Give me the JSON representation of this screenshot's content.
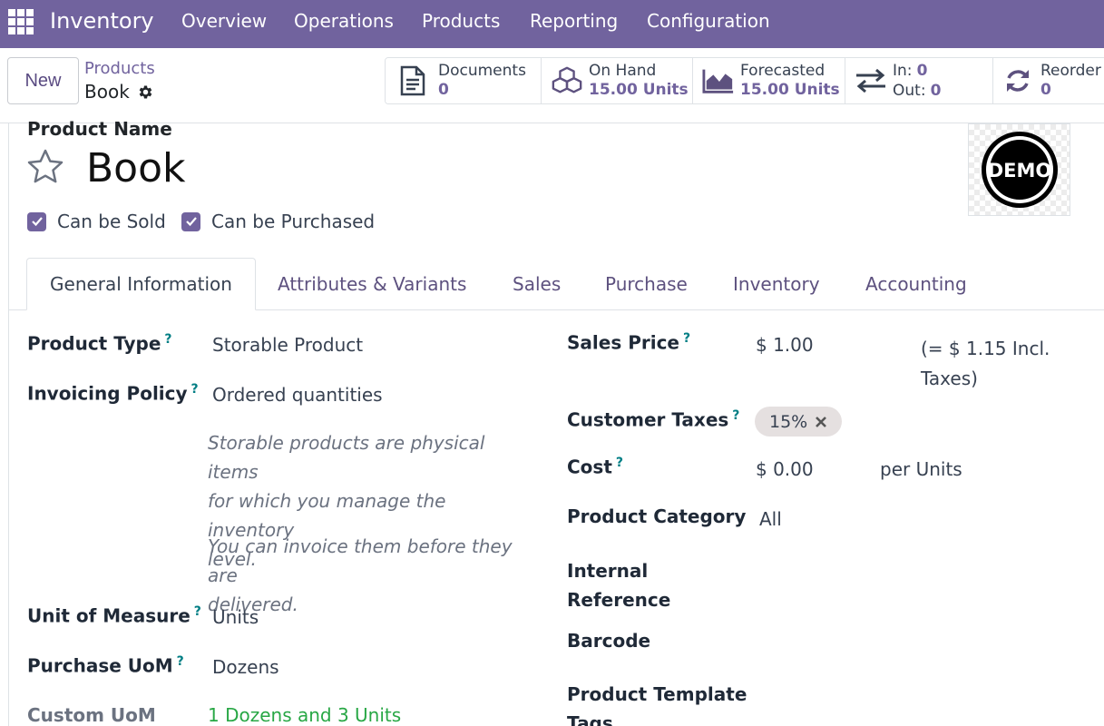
{
  "navbar": {
    "app_name": "Inventory",
    "menu": [
      "Overview",
      "Operations",
      "Products",
      "Reporting",
      "Configuration"
    ]
  },
  "control": {
    "new_label": "New",
    "breadcrumb_parent": "Products",
    "breadcrumb_current": "Book"
  },
  "smart_buttons": {
    "documents": {
      "label": "Documents",
      "value": "0"
    },
    "on_hand": {
      "label": "On Hand",
      "value": "15.00 Units"
    },
    "forecasted": {
      "label": "Forecasted",
      "value": "15.00 Units"
    },
    "in_out": {
      "in_label": "In:",
      "in_value": "0",
      "out_label": "Out:",
      "out_value": "0"
    },
    "reorder": {
      "label": "Reorder",
      "value": "0"
    }
  },
  "form": {
    "product_name_label": "Product Name",
    "product_name": "Book",
    "can_be_sold": "Can be Sold",
    "can_be_purchased": "Can be Purchased",
    "image_text": "DEMO"
  },
  "tabs": [
    "General Information",
    "Attributes & Variants",
    "Sales",
    "Purchase",
    "Inventory",
    "Accounting"
  ],
  "left_fields": {
    "product_type_label": "Product Type",
    "product_type": "Storable Product",
    "invoicing_policy_label": "Invoicing Policy",
    "invoicing_policy": "Ordered quantities",
    "hint_line1": "Storable products are physical items",
    "hint_line2": "for which you manage the inventory",
    "hint_line3": "level.",
    "hint2_line1": "You can invoice them before they are",
    "hint2_line2": "delivered.",
    "uom_label": "Unit of Measure",
    "uom": "Units",
    "purchase_uom_label": "Purchase UoM",
    "purchase_uom": "Dozens",
    "custom_uom_label": "Custom UoM",
    "custom_uom": "1 Dozens and 3 Units"
  },
  "right_fields": {
    "sales_price_label": "Sales Price",
    "sales_price": "$ 1.00",
    "incl_taxes_line1": "(= $ 1.15 Incl.",
    "incl_taxes_line2": "Taxes)",
    "customer_taxes_label": "Customer Taxes",
    "customer_tax_tag": "15%",
    "cost_label": "Cost",
    "cost": "$ 0.00",
    "cost_unit": "per Units",
    "product_category_label": "Product Category",
    "product_category": "All",
    "internal_ref_line1": "Internal",
    "internal_ref_line2": "Reference",
    "barcode_label": "Barcode",
    "template_tags_line1": "Product Template",
    "template_tags_line2": "Tags"
  },
  "help_mark": "?",
  "colors": {
    "brand": "#71639e",
    "link": "#017e84",
    "success": "#28a745"
  }
}
